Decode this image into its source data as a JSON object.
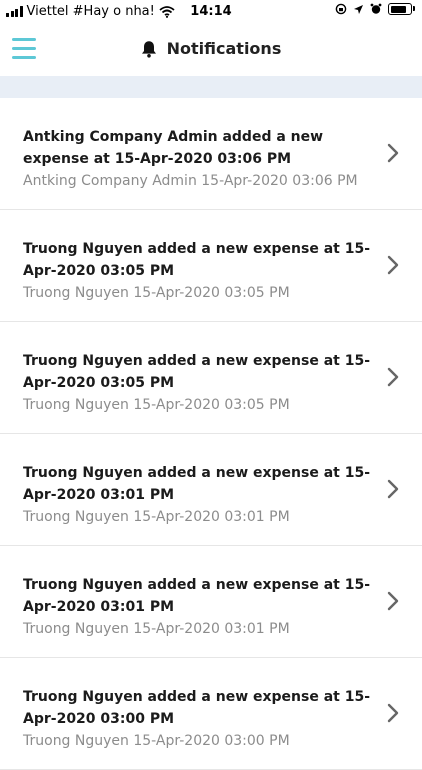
{
  "status_bar": {
    "carrier": "Viettel #Hay o nha!",
    "time": "14:14"
  },
  "header": {
    "title": "Notifications"
  },
  "notifications": [
    {
      "message": "Antking Company Admin added a new expense at 15-Apr-2020 03:06 PM",
      "meta": "Antking Company Admin 15-Apr-2020 03:06 PM"
    },
    {
      "message": "Truong Nguyen added a new expense at 15-Apr-2020 03:05 PM",
      "meta": "Truong Nguyen 15-Apr-2020 03:05 PM"
    },
    {
      "message": "Truong Nguyen added a new expense at 15-Apr-2020 03:05 PM",
      "meta": "Truong Nguyen 15-Apr-2020 03:05 PM"
    },
    {
      "message": "Truong Nguyen added a new expense at 15-Apr-2020 03:01 PM",
      "meta": "Truong Nguyen 15-Apr-2020 03:01 PM"
    },
    {
      "message": "Truong Nguyen added a new expense at 15-Apr-2020 03:01 PM",
      "meta": "Truong Nguyen 15-Apr-2020 03:01 PM"
    },
    {
      "message": "Truong Nguyen added a new expense at 15-Apr-2020 03:00 PM",
      "meta": "Truong Nguyen 15-Apr-2020 03:00 PM"
    }
  ],
  "colors": {
    "accent": "#5dc8d6",
    "band": "#e8eef6",
    "meta_text": "#8c8c8c"
  },
  "icons": {
    "menu": "hamburger-icon",
    "title": "bell-icon",
    "row": "chevron-right-icon"
  }
}
